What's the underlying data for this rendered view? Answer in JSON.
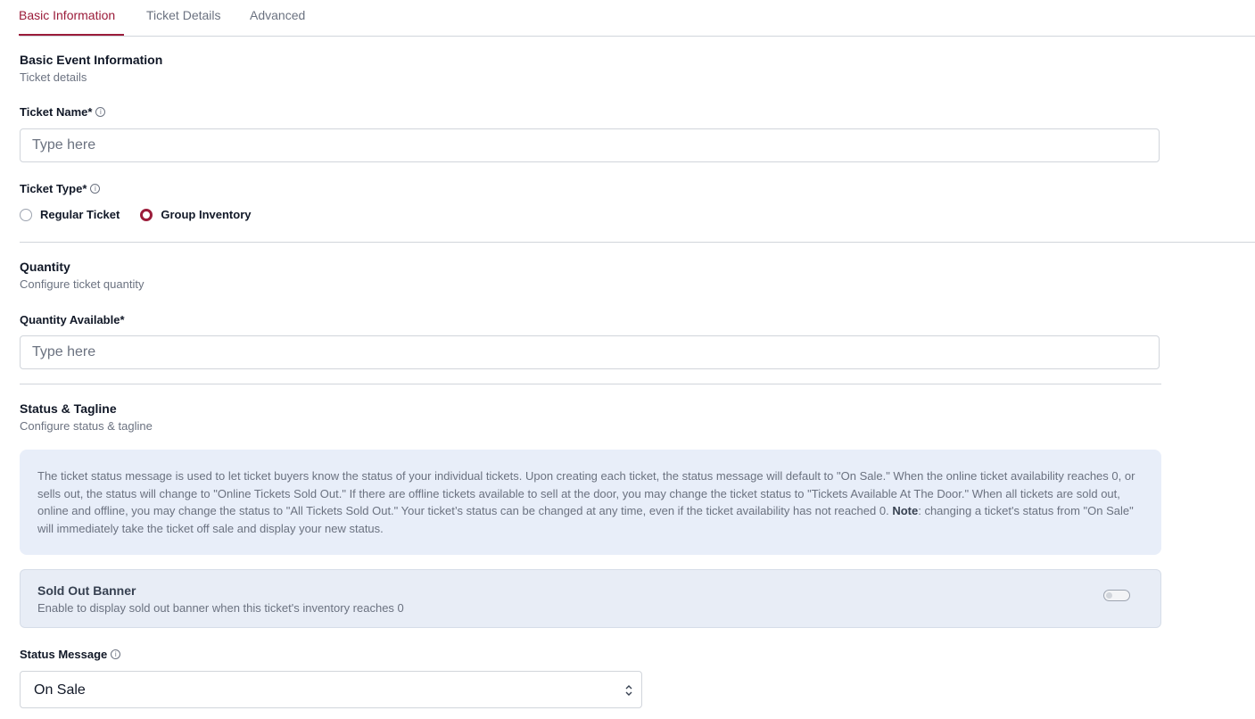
{
  "tabs": [
    "Basic Information",
    "Ticket Details",
    "Advanced"
  ],
  "basic": {
    "title": "Basic Event Information",
    "subtitle": "Ticket details",
    "ticket_name_label": "Ticket Name*",
    "ticket_name_placeholder": "Type here",
    "ticket_type_label": "Ticket Type*",
    "ticket_type_options": [
      "Regular Ticket",
      "Group Inventory"
    ],
    "ticket_type_selected": "Group Inventory"
  },
  "quantity": {
    "title": "Quantity",
    "subtitle": "Configure ticket quantity",
    "available_label": "Quantity Available*",
    "available_placeholder": "Type here"
  },
  "status": {
    "title": "Status & Tagline",
    "subtitle": "Configure status & tagline",
    "info_text": "The ticket status message is used to let ticket buyers know the status of your individual tickets. Upon creating each ticket, the status message will default to \"On Sale.\" When the online ticket availability reaches 0, or sells out, the status will change to \"Online Tickets Sold Out.\" If there are offline tickets available to sell at the door, you may change the ticket status to \"Tickets Available At The Door.\" When all tickets are sold out, online and offline, you may change the status to \"All Tickets Sold Out.\" Your ticket’s status can be changed at any time, even if the ticket availability has not reached 0.",
    "info_note_label": "Note",
    "info_note_text": ": changing a ticket's status from \"On Sale\" will immediately take the ticket off sale and display your new status.",
    "banner_title": "Sold Out Banner",
    "banner_subtitle": "Enable to display sold out banner when this ticket's inventory reaches 0",
    "banner_enabled": false,
    "status_message_label": "Status Message",
    "status_message_value": "On Sale"
  },
  "colors": {
    "accent": "#9b1c3a",
    "info_bg": "#e8eef9"
  }
}
